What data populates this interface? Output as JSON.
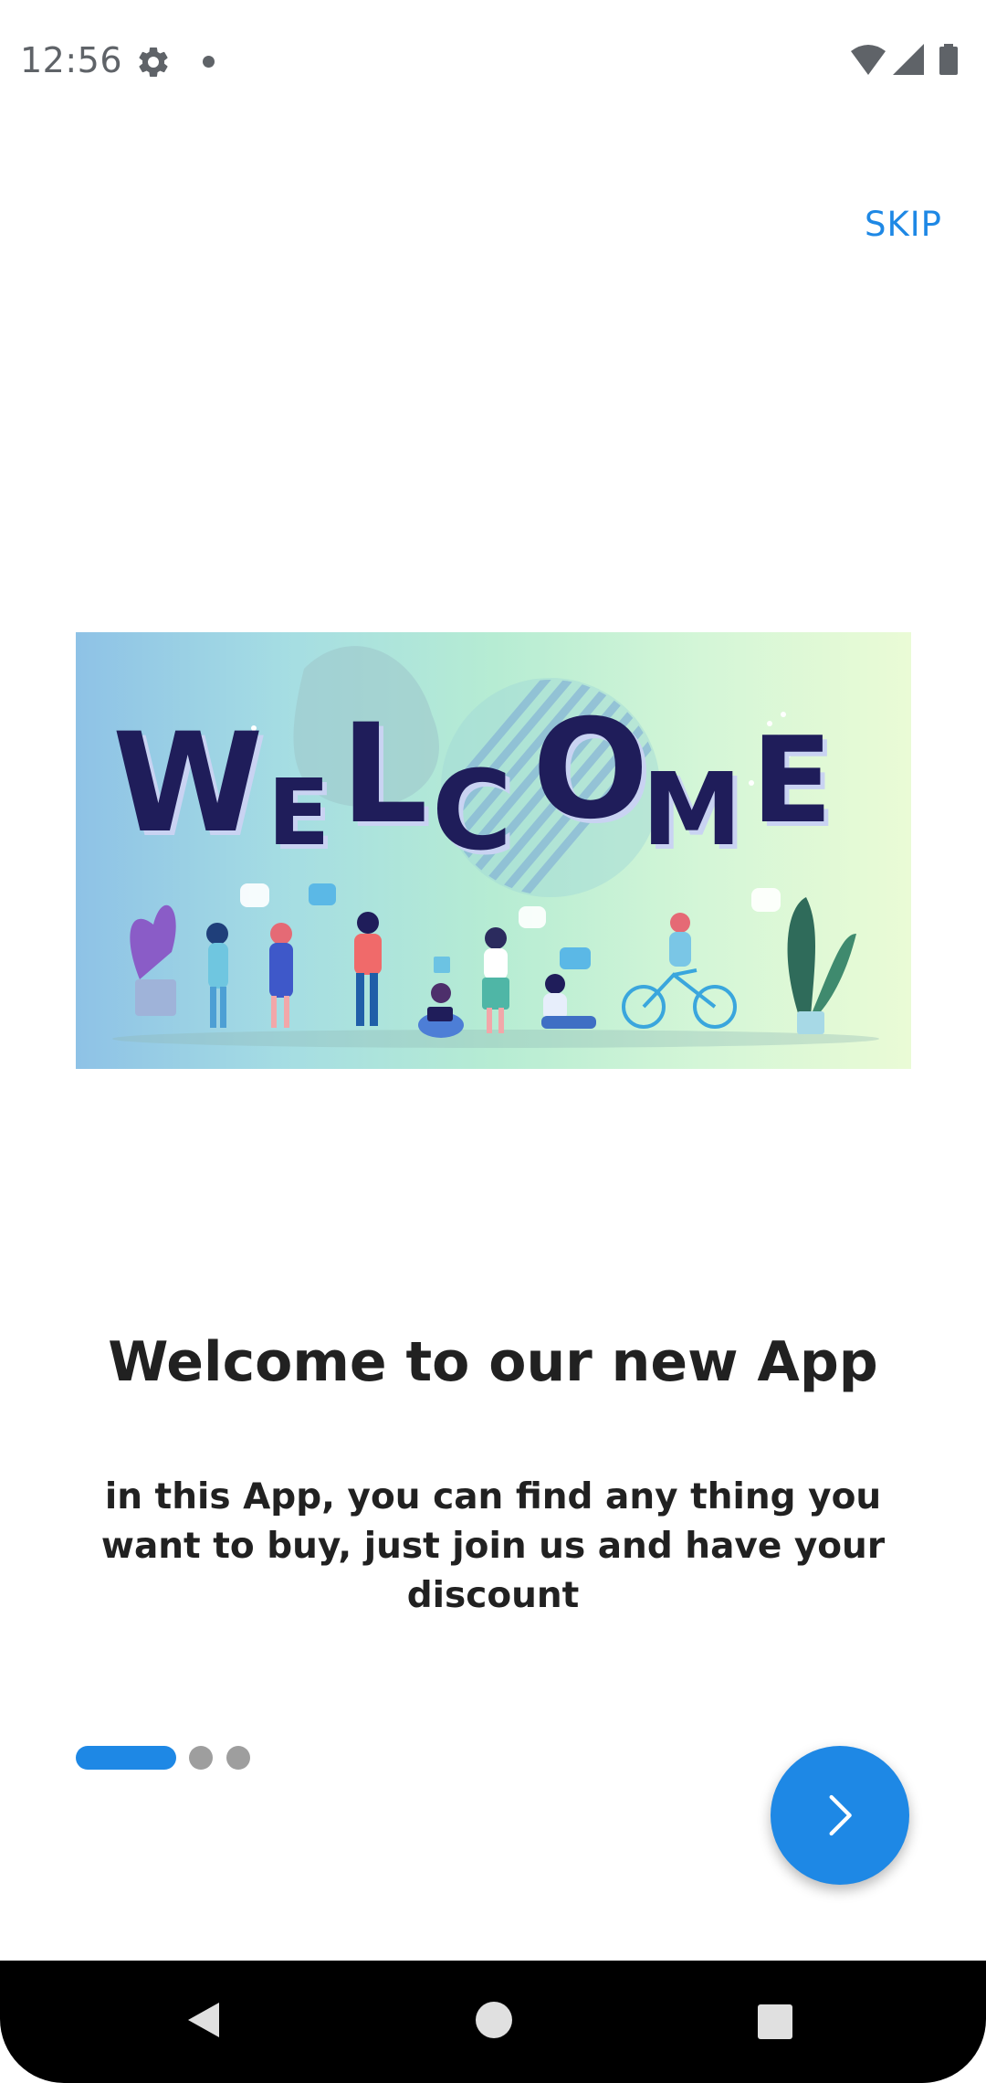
{
  "status_bar": {
    "time": "12:56",
    "icons": [
      "gear-icon",
      "notification-dot-icon",
      "wifi-icon",
      "cellular-signal-icon",
      "battery-icon"
    ]
  },
  "skip_label": "SKIP",
  "banner": {
    "word": "WELCOME"
  },
  "title": "Welcome to our new App",
  "subtitle": "in this App, you can find any thing you want to buy, just join us and have your discount",
  "pager": {
    "total": 3,
    "current": 1
  },
  "fab_icon": "chevron-right-icon",
  "nav_bar": {
    "icons": [
      "back-icon",
      "home-icon",
      "recents-icon"
    ]
  },
  "colors": {
    "accent": "#1e88e5",
    "title_text": "#212121",
    "inactive_dot": "#9e9e9e",
    "banner_text": "#1f1d5a"
  }
}
